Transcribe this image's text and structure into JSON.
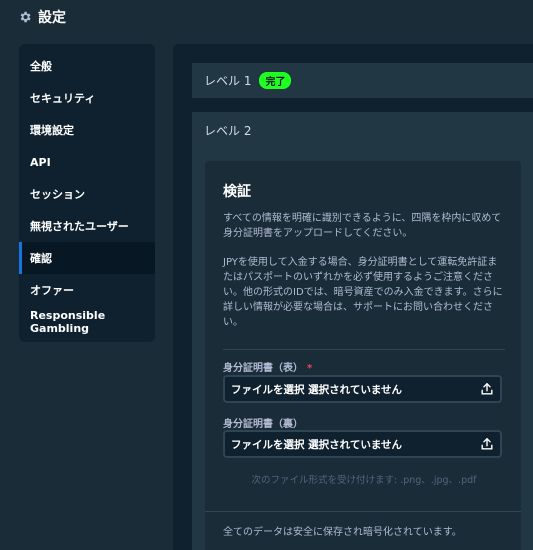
{
  "header": {
    "title": "設定",
    "icon": "gear-icon"
  },
  "sidebar": {
    "items": [
      {
        "label": "全般"
      },
      {
        "label": "セキュリティ"
      },
      {
        "label": "環境設定"
      },
      {
        "label": "API"
      },
      {
        "label": "セッション"
      },
      {
        "label": "無視されたユーザー"
      },
      {
        "label": "確認",
        "active": true
      },
      {
        "label": "オファー"
      },
      {
        "label": "Responsible Gambling"
      }
    ]
  },
  "levels": {
    "level1": {
      "label": "レベル 1",
      "badge": "完了",
      "badge_color": "#1fff20"
    },
    "level2": {
      "label": "レベル 2"
    }
  },
  "verify": {
    "title": "検証",
    "intro": "すべての情報を明確に識別できるように、四隅を枠内に収めて身分証明書をアップロードしてください。",
    "jpy_note": "JPYを使用して入金する場合、身分証明書として運転免許証またはパスポートのいずれかを必ず使用するようご注意ください。他の形式のIDでは、暗号資産でのみ入金できます。さらに詳しい情報が必要な場合は、サポートにお問い合わせください。",
    "front": {
      "label": "身分証明書（表）",
      "required_mark": "*",
      "button_text": "ファイルを選択",
      "status": "選択されていません"
    },
    "back": {
      "label": "身分証明書（裏）",
      "button_text": "ファイルを選択",
      "status": "選択されていません"
    },
    "accepted_formats": "次のファイル形式を受け付けます: .png、.jpg、.pdf",
    "security_note": "全てのデータは安全に保存され暗号化されています。"
  },
  "colors": {
    "background": "#1a2c38",
    "panel": "#0f212e",
    "accent": "#1475e1",
    "success": "#1fff20"
  }
}
